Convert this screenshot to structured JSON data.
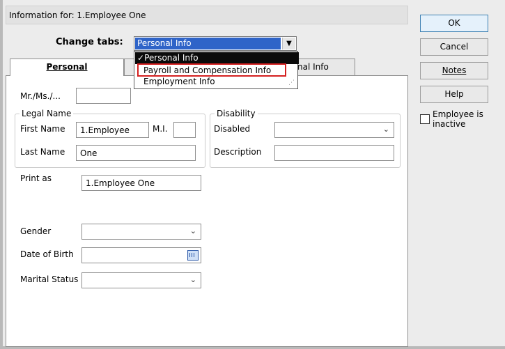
{
  "header": {
    "title": "Information for: 1.Employee One"
  },
  "change_tabs": {
    "label": "Change tabs:",
    "selected": "Personal Info",
    "options": [
      "Personal Info",
      "Payroll and Compensation Info",
      "Employment Info"
    ],
    "checked_mark": "✓"
  },
  "tabs": {
    "personal": "Personal",
    "additional_partial": "nal Info"
  },
  "form": {
    "title_label": "Mr./Ms./...",
    "title_value": "",
    "legal_name_label": "Legal Name",
    "first_name_label": "First Name",
    "first_name_value": "1.Employee",
    "mi_label": "M.I.",
    "mi_value": "",
    "last_name_label": "Last Name",
    "last_name_value": "One",
    "print_as_label": "Print as",
    "print_as_value": "1.Employee One",
    "disability_label": "Disability",
    "disabled_label": "Disabled",
    "disabled_value": "",
    "description_label": "Description",
    "description_value": "",
    "gender_label": "Gender",
    "gender_value": "",
    "dob_label": "Date of Birth",
    "dob_value": "",
    "marital_label": "Marital Status",
    "marital_value": ""
  },
  "buttons": {
    "ok": "OK",
    "cancel": "Cancel",
    "notes": "Notes",
    "help": "Help"
  },
  "inactive": {
    "label_line1": "Employee is",
    "label_line2": "inactive",
    "checked": false
  },
  "colors": {
    "selection": "#2f64c8",
    "highlight": "#d42020"
  }
}
